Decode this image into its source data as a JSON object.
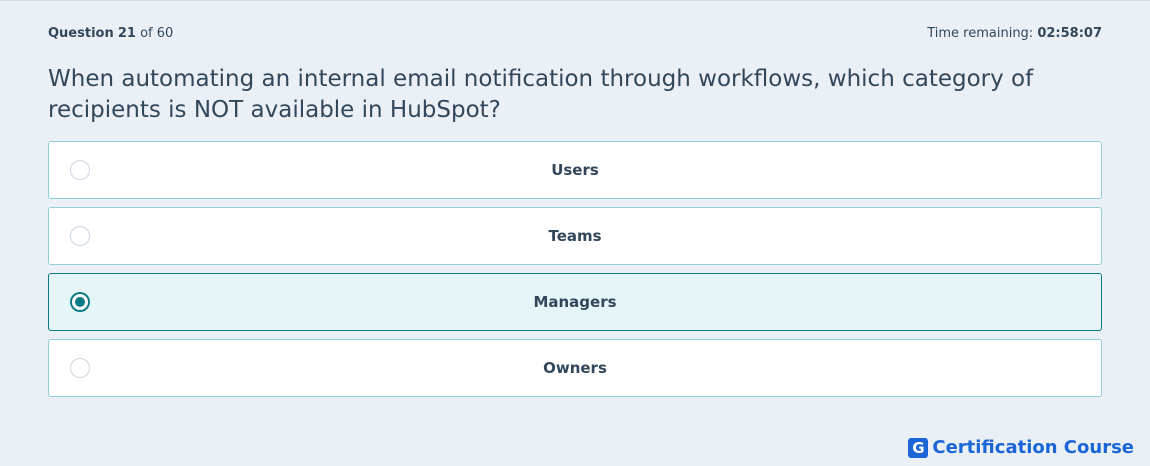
{
  "header": {
    "question_label": "Question",
    "question_number": "21",
    "question_of": "of 60",
    "time_label": "Time remaining:",
    "time_value": "02:58:07"
  },
  "question": {
    "text": "When automating an internal email notification through workflows, which category of recipients is NOT available in HubSpot?"
  },
  "options": [
    {
      "label": "Users",
      "selected": false
    },
    {
      "label": "Teams",
      "selected": false
    },
    {
      "label": "Managers",
      "selected": true
    },
    {
      "label": "Owners",
      "selected": false
    }
  ],
  "brand": {
    "logo_letter": "G",
    "name": "Certification Course",
    "color": "#1a66d6"
  },
  "colors": {
    "accent": "#0b7c86",
    "background": "#eaf0f6",
    "text": "#33475b"
  }
}
